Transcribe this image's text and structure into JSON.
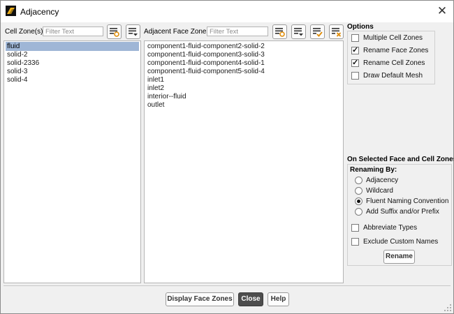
{
  "window": {
    "title": "Adjacency"
  },
  "cell_zones": {
    "label": "Cell Zone(s)",
    "filter_placeholder": "Filter Text",
    "items": [
      {
        "label": "fluid",
        "selected": true
      },
      {
        "label": "solid-2",
        "selected": false
      },
      {
        "label": "solid-2336",
        "selected": false
      },
      {
        "label": "solid-3",
        "selected": false
      },
      {
        "label": "solid-4",
        "selected": false
      }
    ]
  },
  "face_zones": {
    "label": "Adjacent Face Zones",
    "filter_placeholder": "Filter Text",
    "items": [
      "component1-fluid-component2-solid-2",
      "component1-fluid-component3-solid-3",
      "component1-fluid-component4-solid-1",
      "component1-fluid-component5-solid-4",
      "inlet1",
      "inlet2",
      "interior--fluid",
      "outlet"
    ]
  },
  "options": {
    "title": "Options",
    "items": [
      {
        "label": "Multiple Cell Zones",
        "checked": false
      },
      {
        "label": "Rename Face Zones",
        "checked": true
      },
      {
        "label": "Rename Cell Zones",
        "checked": true
      },
      {
        "label": "Draw Default Mesh",
        "checked": false
      }
    ]
  },
  "on_selected": {
    "title": "On Selected Face and Cell Zones",
    "renaming_by_label": "Renaming By:",
    "radios": [
      {
        "label": "Adjacency",
        "selected": false
      },
      {
        "label": "Wildcard",
        "selected": false
      },
      {
        "label": "Fluent Naming Convention",
        "selected": true
      },
      {
        "label": "Add Suffix and/or Prefix",
        "selected": false
      }
    ],
    "checks": [
      {
        "label": "Abbreviate Types",
        "checked": false
      },
      {
        "label": "Exclude Custom Names",
        "checked": false
      }
    ],
    "rename_label": "Rename"
  },
  "footer": {
    "display_face_zones": "Display Face Zones",
    "close": "Close",
    "help": "Help"
  },
  "colors": {
    "selection": "#9fb6d6",
    "primary_button": "#4d4d4d",
    "dialog_bg": "#f0f0f0"
  }
}
